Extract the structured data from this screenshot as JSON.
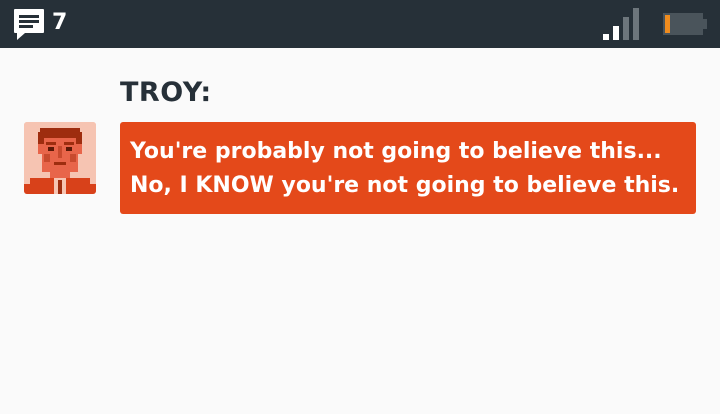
{
  "status_bar": {
    "message_count": "7",
    "message_icon": "chat-bubble-icon",
    "signal_icon": "signal-strength-icon",
    "battery_icon": "battery-low-icon"
  },
  "dialogue": {
    "speaker": "TROY:",
    "avatar": "troy-portrait",
    "lines": [
      "You're probably not going to believe this...",
      "No, I KNOW you're not going to believe this."
    ]
  },
  "colors": {
    "status_bar_bg": "#263038",
    "background": "#fafafa",
    "bubble": "#e4491a",
    "speaker_text": "#263038",
    "battery_level": "#f08c1e"
  }
}
